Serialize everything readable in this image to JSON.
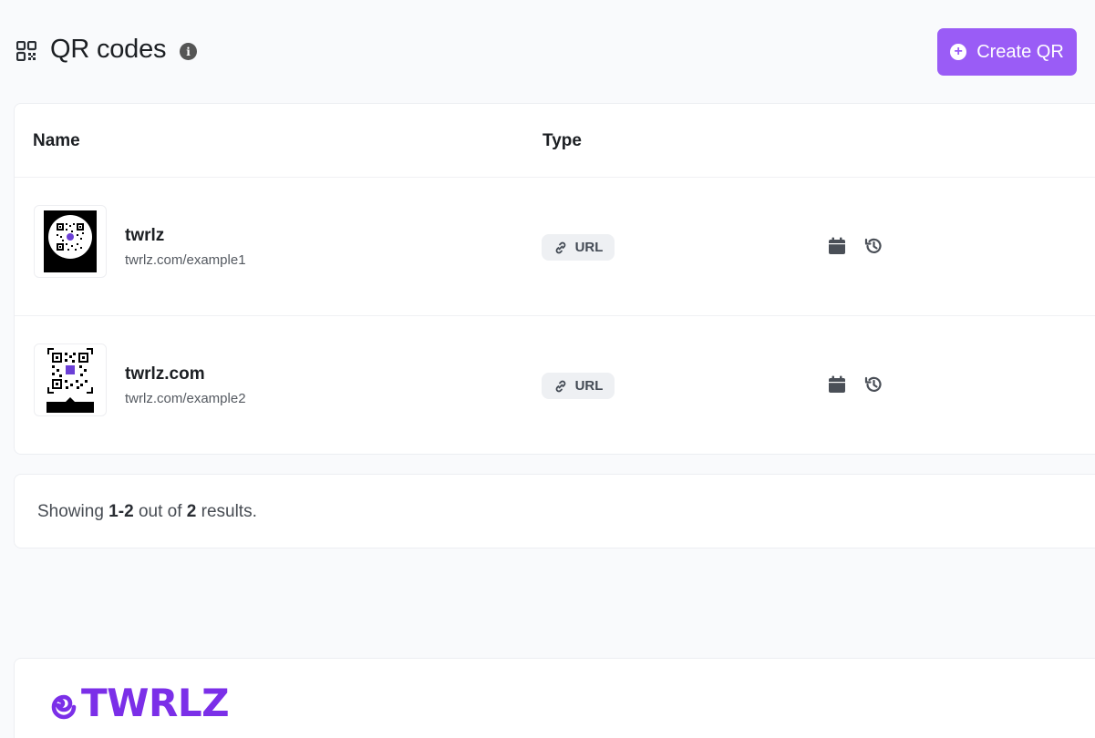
{
  "header": {
    "title": "QR codes",
    "info_icon": "info-icon",
    "create_button_label": "Create QR"
  },
  "table": {
    "columns": [
      "Name",
      "Type"
    ],
    "rows": [
      {
        "name": "twrlz",
        "url": "twrlz.com/example1",
        "type": "URL"
      },
      {
        "name": "twrlz.com",
        "url": "twrlz.com/example2",
        "type": "URL"
      }
    ]
  },
  "pagination": {
    "prefix": "Showing",
    "range_start": "1",
    "range_end": "2",
    "middle": "out of",
    "total": "2",
    "suffix": "results."
  },
  "footer": {
    "logo_text": "TWRLZ"
  },
  "colors": {
    "accent": "#9a5cf6",
    "logo": "#7b2fe8"
  }
}
